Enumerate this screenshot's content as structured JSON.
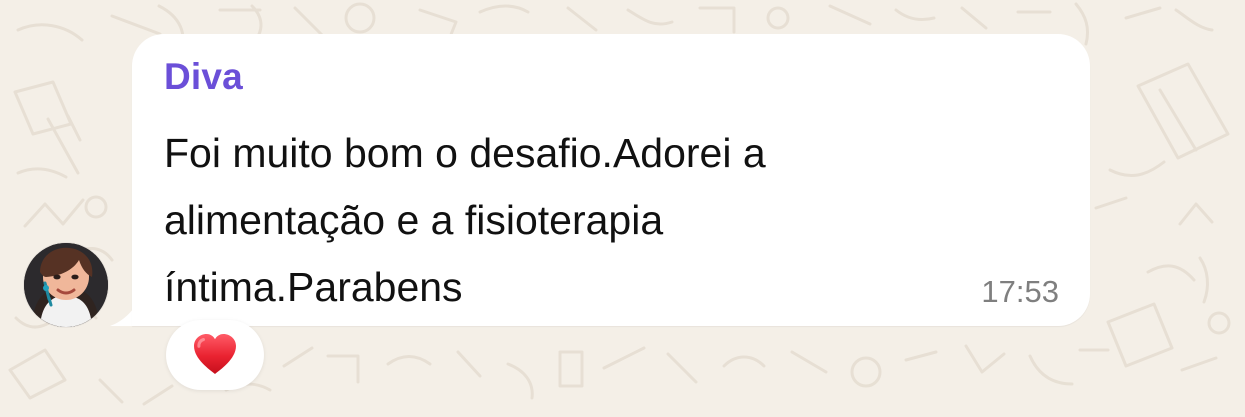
{
  "message": {
    "sender": "Diva",
    "text": "Foi muito bom o desafio.Adorei a\nalimentação e a fisioterapia\níntima.Parabens",
    "time": "17:53",
    "reaction": "❤️"
  },
  "colors": {
    "background": "#f4efe7",
    "bubble": "#ffffff",
    "sender": "#6b4fd8",
    "text": "#111111",
    "timestamp": "#7f7f7f",
    "reaction_heart": "#e11d2e"
  },
  "icons": {
    "avatar": "profile-photo",
    "reaction": "heart-icon"
  }
}
